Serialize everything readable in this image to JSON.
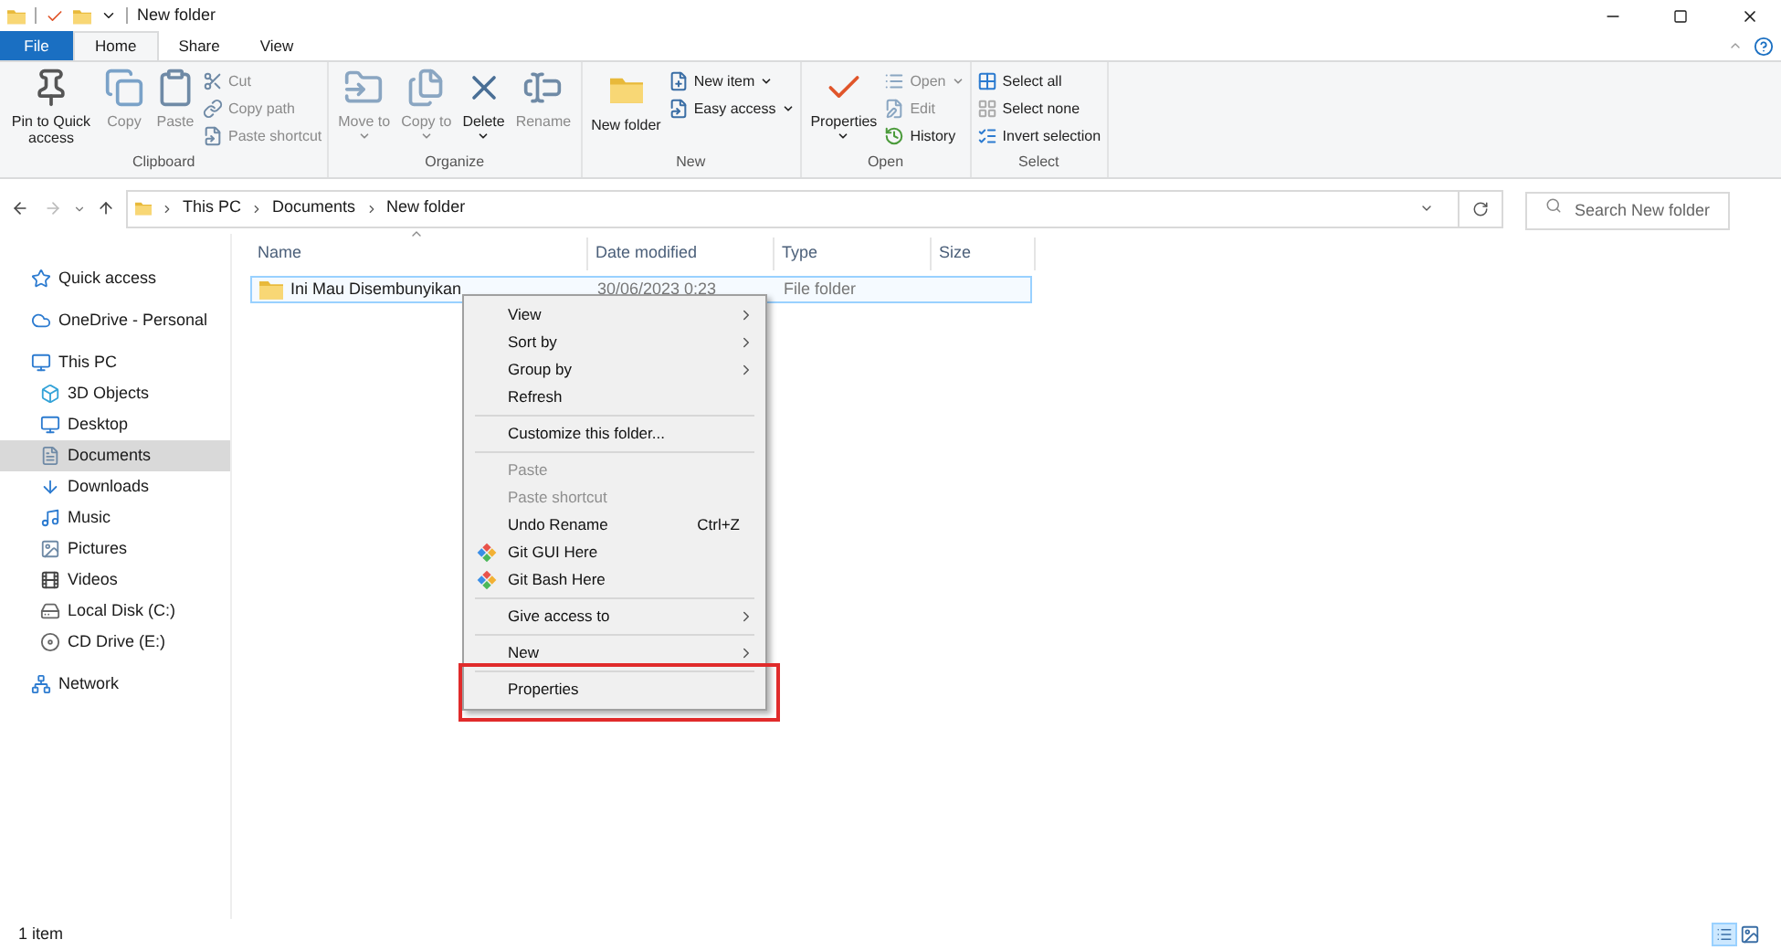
{
  "window": {
    "title": "New folder"
  },
  "ribbon_tabs": [
    {
      "label": "File",
      "kind": "file",
      "selected": false
    },
    {
      "label": "Home",
      "kind": "tab",
      "selected": true
    },
    {
      "label": "Share",
      "kind": "tab",
      "selected": false
    },
    {
      "label": "View",
      "kind": "tab",
      "selected": false
    }
  ],
  "ribbon": {
    "groups": [
      {
        "label": "Clipboard",
        "buttons": [
          {
            "label": "Pin to Quick access",
            "kind": "large",
            "disabled": false,
            "dropdown": false
          },
          {
            "label": "Copy",
            "kind": "large",
            "disabled": true,
            "dropdown": false
          },
          {
            "label": "Paste",
            "kind": "large",
            "disabled": true,
            "dropdown": false
          },
          {
            "label": "Cut",
            "kind": "small",
            "disabled": true,
            "dropdown": false
          },
          {
            "label": "Copy path",
            "kind": "small",
            "disabled": true,
            "dropdown": false
          },
          {
            "label": "Paste shortcut",
            "kind": "small",
            "disabled": true,
            "dropdown": false
          }
        ]
      },
      {
        "label": "Organize",
        "buttons": [
          {
            "label": "Move to",
            "kind": "large",
            "disabled": true,
            "dropdown": true
          },
          {
            "label": "Copy to",
            "kind": "large",
            "disabled": true,
            "dropdown": true
          },
          {
            "label": "Delete",
            "kind": "large",
            "disabled": false,
            "dropdown": true
          },
          {
            "label": "Rename",
            "kind": "large",
            "disabled": true,
            "dropdown": false
          }
        ]
      },
      {
        "label": "New",
        "buttons": [
          {
            "label": "New folder",
            "kind": "large",
            "disabled": false,
            "dropdown": false
          },
          {
            "label": "New item",
            "kind": "small",
            "disabled": false,
            "dropdown": true
          },
          {
            "label": "Easy access",
            "kind": "small",
            "disabled": false,
            "dropdown": true
          }
        ]
      },
      {
        "label": "Open",
        "buttons": [
          {
            "label": "Properties",
            "kind": "large",
            "disabled": false,
            "dropdown": true
          },
          {
            "label": "Open",
            "kind": "small",
            "disabled": true,
            "dropdown": true
          },
          {
            "label": "Edit",
            "kind": "small",
            "disabled": true,
            "dropdown": false
          },
          {
            "label": "History",
            "kind": "small",
            "disabled": false,
            "dropdown": false
          }
        ]
      },
      {
        "label": "Select",
        "buttons": [
          {
            "label": "Select all",
            "kind": "small",
            "disabled": false,
            "dropdown": false
          },
          {
            "label": "Select none",
            "kind": "small",
            "disabled": false,
            "dropdown": false
          },
          {
            "label": "Invert selection",
            "kind": "small",
            "disabled": false,
            "dropdown": false
          }
        ]
      }
    ]
  },
  "address_bar": {
    "breadcrumb": [
      "This PC",
      "Documents",
      "New folder"
    ]
  },
  "search": {
    "placeholder": "Search New folder"
  },
  "sidebar": {
    "items": [
      {
        "label": "Quick access",
        "selected": false
      },
      {
        "label": "OneDrive - Personal",
        "selected": false
      },
      {
        "label": "This PC",
        "selected": false,
        "children": [
          {
            "label": "3D Objects",
            "selected": false
          },
          {
            "label": "Desktop",
            "selected": false
          },
          {
            "label": "Documents",
            "selected": true
          },
          {
            "label": "Downloads",
            "selected": false
          },
          {
            "label": "Music",
            "selected": false
          },
          {
            "label": "Pictures",
            "selected": false
          },
          {
            "label": "Videos",
            "selected": false
          },
          {
            "label": "Local Disk (C:)",
            "selected": false
          },
          {
            "label": "CD Drive (E:)",
            "selected": false
          }
        ]
      },
      {
        "label": "Network",
        "selected": false
      }
    ]
  },
  "table": {
    "columns": [
      "Name",
      "Date modified",
      "Type",
      "Size"
    ],
    "rows": [
      {
        "cells": [
          "Ini Mau Disembunyikan",
          "30/06/2023 0:23",
          "File folder"
        ],
        "selected": true
      }
    ]
  },
  "context_menu": {
    "items": [
      {
        "kind": "entry",
        "label": "View",
        "submenu": true,
        "disabled": false
      },
      {
        "kind": "entry",
        "label": "Sort by",
        "submenu": true,
        "disabled": false
      },
      {
        "kind": "entry",
        "label": "Group by",
        "submenu": true,
        "disabled": false
      },
      {
        "kind": "entry",
        "label": "Refresh",
        "submenu": false,
        "disabled": false
      },
      {
        "kind": "separator"
      },
      {
        "kind": "entry",
        "label": "Customize this folder...",
        "submenu": false,
        "disabled": false
      },
      {
        "kind": "separator"
      },
      {
        "kind": "entry",
        "label": "Paste",
        "submenu": false,
        "disabled": true
      },
      {
        "kind": "entry",
        "label": "Paste shortcut",
        "submenu": false,
        "disabled": true
      },
      {
        "kind": "entry",
        "label": "Undo Rename",
        "shortcut": "Ctrl+Z",
        "submenu": false,
        "disabled": false
      },
      {
        "kind": "app_entry",
        "label": "Git GUI Here",
        "submenu": false,
        "disabled": false
      },
      {
        "kind": "app_entry",
        "label": "Git Bash Here",
        "submenu": false,
        "disabled": false
      },
      {
        "kind": "separator"
      },
      {
        "kind": "entry",
        "label": "Give access to",
        "submenu": true,
        "disabled": false
      },
      {
        "kind": "separator"
      },
      {
        "kind": "entry",
        "label": "New",
        "submenu": true,
        "disabled": false
      },
      {
        "kind": "separator"
      },
      {
        "kind": "entry",
        "label": "Properties",
        "submenu": false,
        "disabled": false,
        "highlighted": true
      }
    ]
  },
  "status_bar": {
    "text": "1 item",
    "views": [
      {
        "selected": true
      },
      {
        "selected": false
      }
    ]
  }
}
